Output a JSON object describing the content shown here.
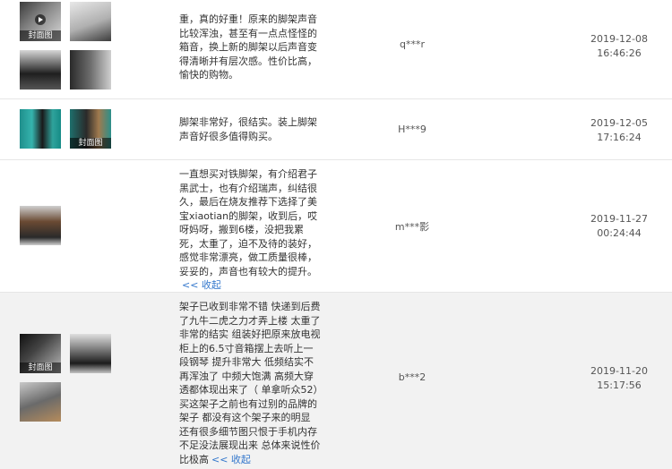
{
  "common": {
    "cover_label": "封面图",
    "collapse_label": "<< 收起"
  },
  "reviews": [
    {
      "text": "重，真的好重！原来的脚架声音比较浑浊，甚至有一点点怪怪的箱音，换上新的脚架以后声音变得清晰并有层次感。性价比高，愉快的购物。",
      "user": "q***r",
      "date": "2019-12-08",
      "time": "16:46:26"
    },
    {
      "text": "脚架非常好，很结实。装上脚架声音好很多值得购买。",
      "user": "H***9",
      "date": "2019-12-05",
      "time": "17:16:24"
    },
    {
      "text": "一直想买对铁脚架，有介绍君子黑武士，也有介绍瑞声，纠结很久，最后在烧友推荐下选择了美宝xiaotian的脚架，收到后，哎呀妈呀，搬到6楼，没把我累死，太重了，迫不及待的装好，感觉非常漂亮，做工质量很棒，妥妥的，声音也有较大的提升。",
      "user": "m***影",
      "date": "2019-11-27",
      "time": "00:24:44"
    },
    {
      "text": "架子已收到非常不错 快递到后费了九牛二虎之力才弄上楼 太重了 非常的结实 组装好把原来放电视柜上的6.5寸音箱摆上去听上一段钢琴 提升非常大 低频结实不再浑浊了 中频大饱满 高频大穿透都体现出来了（ 单拿听众52）买这架子之前也有过别的品牌的架子 都没有这个架子来的明显 还有很多细节图只恨于手机内存不足没法展现出来 总体来说性价比极高",
      "user": "b***2",
      "date": "2019-11-20",
      "time": "15:17:56"
    }
  ]
}
